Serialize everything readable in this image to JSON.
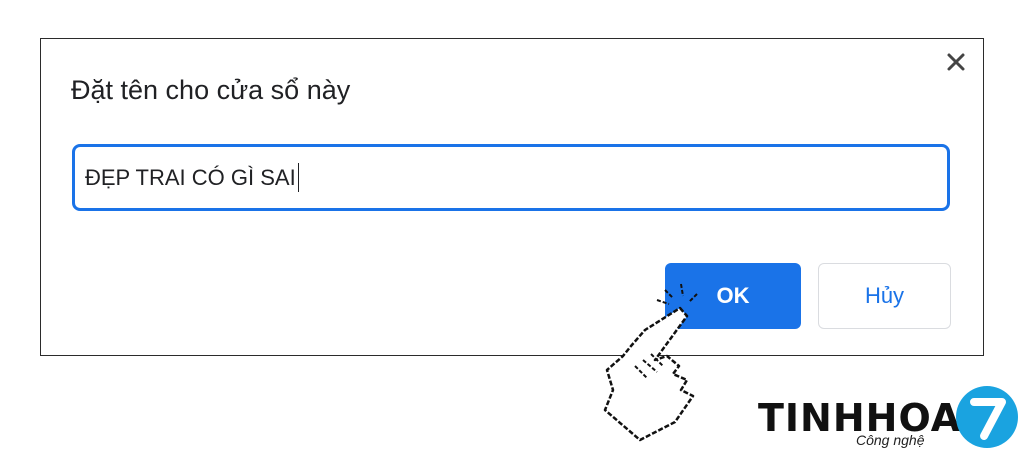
{
  "dialog": {
    "title": "Đặt tên cho cửa sổ này",
    "input_value": "ĐẸP TRAI CÓ GÌ SAI",
    "ok_label": "OK",
    "cancel_label": "Hủy",
    "close_icon": "close-icon"
  },
  "cursor": {
    "icon": "hand-pointer-icon"
  },
  "watermark": {
    "brand": "TINHHOA",
    "tagline": "Công nghệ",
    "badge_number": "7",
    "badge_color": "#1aa3e0"
  },
  "colors": {
    "accent": "#1a73e8",
    "dialog_border": "#2b2b2b"
  }
}
